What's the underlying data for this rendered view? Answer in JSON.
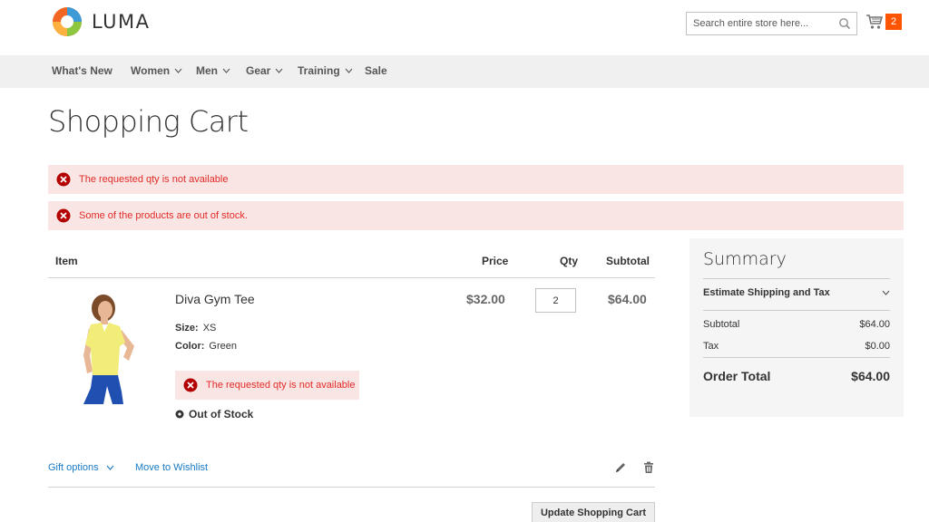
{
  "header": {
    "logo_text": "LUMA",
    "search_placeholder": "Search entire store here...",
    "cart_count": "2"
  },
  "nav": {
    "items": [
      {
        "label": "What's New"
      },
      {
        "label": "Women"
      },
      {
        "label": "Men"
      },
      {
        "label": "Gear"
      },
      {
        "label": "Training"
      },
      {
        "label": "Sale"
      }
    ]
  },
  "page": {
    "title": "Shopping Cart"
  },
  "messages": [
    {
      "text": "The requested qty is not available"
    },
    {
      "text": "Some of the products are out of stock."
    }
  ],
  "cart": {
    "headers": {
      "item": "Item",
      "price": "Price",
      "qty": "Qty",
      "subtotal": "Subtotal"
    },
    "item": {
      "name": "Diva Gym Tee",
      "size_label": "Size:",
      "size_value": "XS",
      "color_label": "Color:",
      "color_value": "Green",
      "error": "The requested qty is not available",
      "stock_status": "Out of Stock",
      "price": "$32.00",
      "qty": "2",
      "subtotal": "$64.00",
      "gift_options": "Gift options",
      "move_to_wishlist": "Move to Wishlist"
    },
    "update_button": "Update Shopping Cart"
  },
  "summary": {
    "title": "Summary",
    "estimate_label": "Estimate Shipping and Tax",
    "subtotal_label": "Subtotal",
    "subtotal_value": "$64.00",
    "tax_label": "Tax",
    "tax_value": "$0.00",
    "order_total_label": "Order Total",
    "order_total_value": "$64.00"
  },
  "colors": {
    "accent_orange": "#ff5501",
    "link_blue": "#1979c3",
    "error_red": "#e02b27",
    "error_bg": "#fae5e5"
  }
}
